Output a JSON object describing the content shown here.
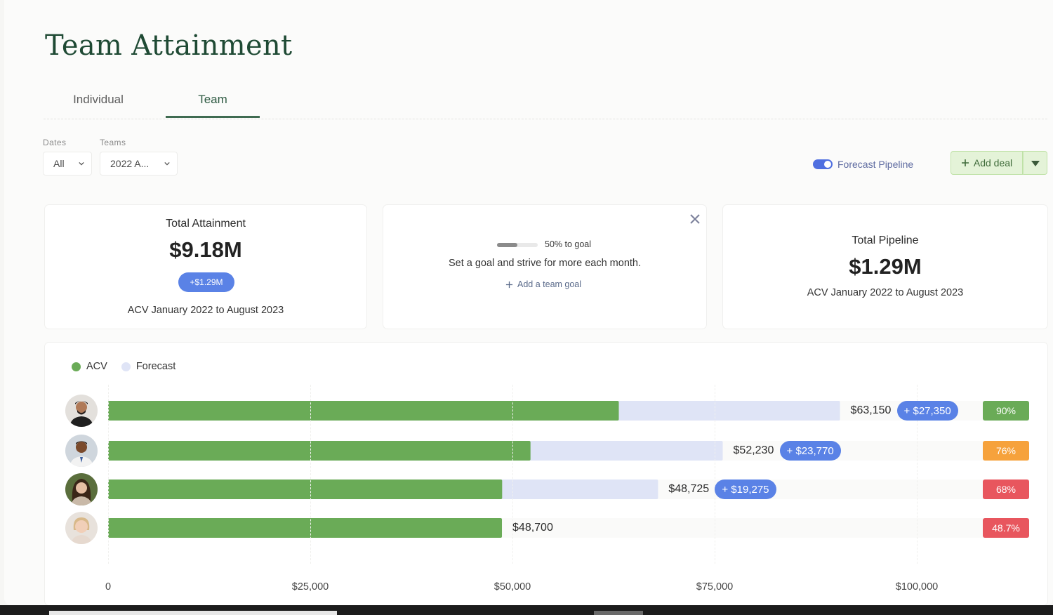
{
  "header": {
    "title": "Team Attainment"
  },
  "tabs": [
    {
      "label": "Individual"
    },
    {
      "label": "Team"
    }
  ],
  "filters": {
    "dates": {
      "label": "Dates",
      "value": "All"
    },
    "teams": {
      "label": "Teams",
      "value": "2022 A..."
    }
  },
  "toolbar": {
    "forecast_toggle_label": "Forecast Pipeline",
    "add_deal_label": "Add deal"
  },
  "cards": {
    "attainment": {
      "label": "Total Attainment",
      "value": "$9.18M",
      "delta": "+$1.29M",
      "subtitle": "ACV January 2022 to August 2023"
    },
    "goal": {
      "progress_text": "50% to goal",
      "progress": 0.5,
      "message": "Set a goal and strive for more each month.",
      "add_label": "Add a team goal"
    },
    "pipeline": {
      "label": "Total Pipeline",
      "value": "$1.29M",
      "subtitle": "ACV January 2022 to August 2023"
    }
  },
  "chart_data": {
    "type": "bar",
    "orientation": "horizontal",
    "stacked": true,
    "legend": [
      {
        "name": "ACV",
        "color": "#6aab57"
      },
      {
        "name": "Forecast",
        "color": "#dfe4f6"
      }
    ],
    "xlim": [
      0,
      100000
    ],
    "x_ticks": [
      "0",
      "$25,000",
      "$50,000",
      "$75,000",
      "$100,000"
    ],
    "x_tick_values": [
      0,
      25000,
      50000,
      75000,
      100000
    ],
    "rows": [
      {
        "acv": 63150,
        "forecast": 27350,
        "acv_label": "$63,150",
        "forecast_label": "+ $27,350",
        "pct": "90%",
        "pct_color": "#6aab57"
      },
      {
        "acv": 52230,
        "forecast": 23770,
        "acv_label": "$52,230",
        "forecast_label": "+ $23,770",
        "pct": "76%",
        "pct_color": "#f6a23c"
      },
      {
        "acv": 48725,
        "forecast": 19275,
        "acv_label": "$48,725",
        "forecast_label": "+ $19,275",
        "pct": "68%",
        "pct_color": "#e8565e"
      },
      {
        "acv": 48700,
        "forecast": 0,
        "acv_label": "$48,700",
        "forecast_label": "",
        "pct": "48.7%",
        "pct_color": "#e8565e"
      }
    ]
  }
}
